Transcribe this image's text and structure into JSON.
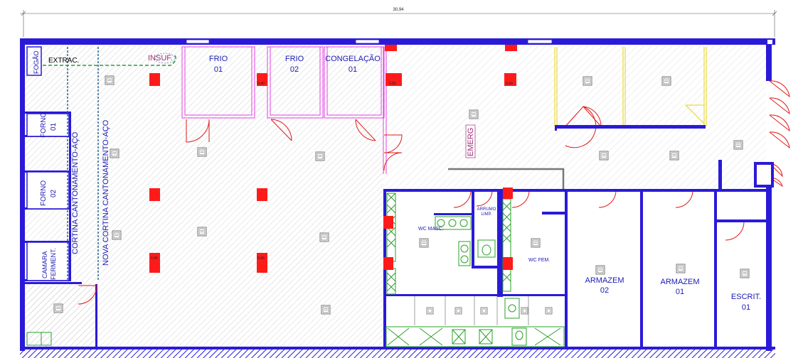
{
  "plan": {
    "overall_dimension": "30,94",
    "colors": {
      "wall": "#2a1ad8",
      "emergency_light": "#ff1a1a",
      "cold_room_line": "#e040e0",
      "sanitary": "#2aa02a",
      "extraction_line": "#2a9a4a",
      "curtain_line": "#1a5a8a",
      "yellow_partition": "#e6d21a"
    },
    "labels": {
      "fogao": "FOGÃO",
      "extrac": "EXTRAC.",
      "insuf": "INSUF.",
      "frio01_a": "FRIO",
      "frio01_b": "01",
      "frio02_a": "FRIO",
      "frio02_b": "02",
      "cong_a": "CONGELAÇÃO",
      "cong_b": "01",
      "forno01_a": "FORNO",
      "forno01_b": "01",
      "forno02_a": "FORNO",
      "forno02_b": "02",
      "camara_a": "CAMARA",
      "camara_b": "FERMENT.",
      "cortina": "CORTINA CANTONAMENTO-AÇO",
      "nova_cortina": "NOVA CORTINA CANTONAMENTO-AÇO",
      "emerg": "EMERG",
      "wc_masc": "WC MASC.",
      "arrumo_a": "ARRUMO",
      "arrumo_b": "LIMP.",
      "wc_fem": "WC FEM.",
      "armazem02_a": "ARMAZEM",
      "armazem02_b": "02",
      "armazem01_a": "ARMAZEM",
      "armazem01_b": "01",
      "escrit_a": "ESCRIT.",
      "escrit_b": "01"
    },
    "light_tags": [
      "0,40",
      "0,40",
      "0,80",
      "0,40",
      "0,40",
      "0,40"
    ]
  }
}
